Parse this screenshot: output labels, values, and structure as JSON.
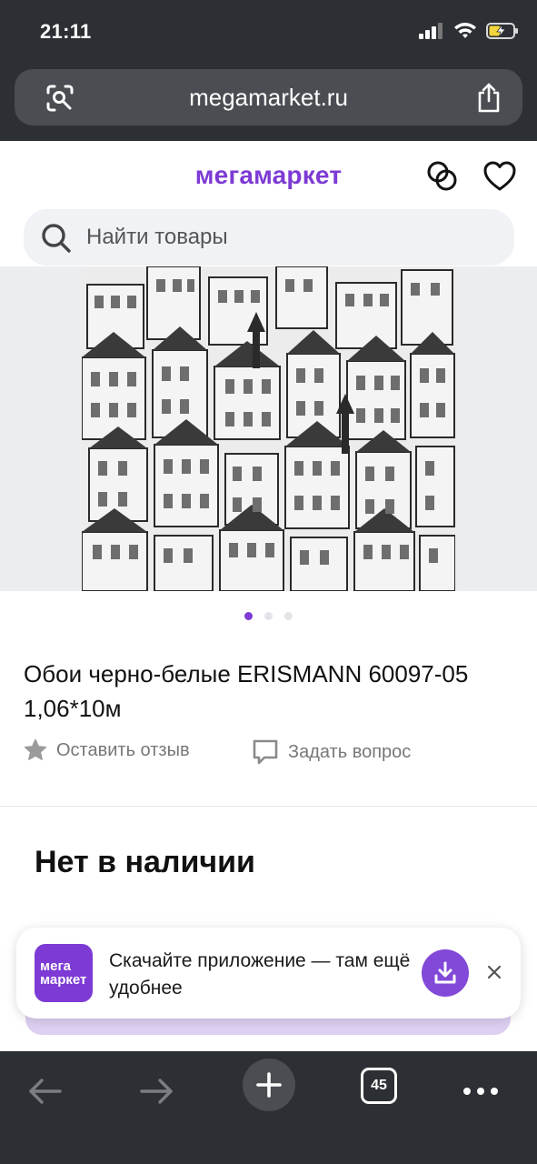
{
  "status_bar": {
    "time": "21:11"
  },
  "browser": {
    "url": "megamarket.ru",
    "tabs_count": "45",
    "icons": [
      "lens-icon",
      "share-icon",
      "back-arrow-icon",
      "forward-arrow-icon",
      "plus-icon",
      "tabs-icon",
      "more-dots-icon"
    ]
  },
  "site": {
    "logo": "мегамаркет",
    "search_placeholder": "Найти товары"
  },
  "gallery": {
    "slide_count": 3,
    "active_slide": 1
  },
  "product": {
    "title": "Обои черно-белые ERISMANN 60097-05 1,06*10м",
    "review_label": "Оставить отзыв",
    "question_label": "Задать вопрос",
    "availability": "Нет в наличии"
  },
  "promo": {
    "logo_line1": "мега",
    "logo_line2": "маркет",
    "text": "Скачайте приложение — там ещё удобнее"
  },
  "colors": {
    "brand": "#7d3ad4",
    "chrome": "#2c2f33",
    "search_bg": "#f0f2f6"
  }
}
